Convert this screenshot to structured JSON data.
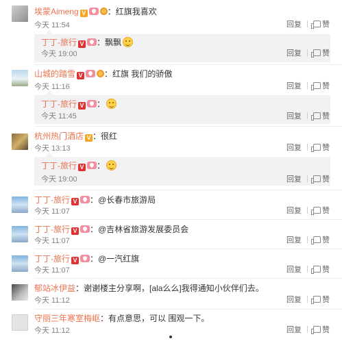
{
  "labels": {
    "reply": "回复",
    "like": "赞"
  },
  "comments": [
    {
      "user": "埃蒙Aimeng",
      "text": "：红旗我喜欢",
      "time": "今天 11:54",
      "reply": {
        "user": "丁丁-旅行",
        "text": "：飘飘",
        "time": "今天 19:00"
      }
    },
    {
      "user": "山城的踏雪",
      "text": "：红旗 我们的骄傲",
      "time": "今天 11:16",
      "reply": {
        "user": "丁丁-旅行",
        "text": "：",
        "time": "今天 11:45"
      }
    },
    {
      "user": "杭州热门酒店",
      "text": "：很红",
      "time": "今天 13:13",
      "reply": {
        "user": "丁丁-旅行",
        "text": "：",
        "time": "今天 19:00"
      }
    },
    {
      "user": "丁丁-旅行",
      "text": "：@长春市旅游局",
      "time": "今天 11:07"
    },
    {
      "user": "丁丁-旅行",
      "text": "：@吉林省旅游发展委员会",
      "time": "今天 11:07"
    },
    {
      "user": "丁丁-旅行",
      "text": "：@一汽红旗",
      "time": "今天 11:07"
    },
    {
      "user": "郁站冰伊益",
      "text": "：谢谢楼主分享啊，[ala么么]我得通知小伙伴们去。",
      "time": "今天 11:12"
    },
    {
      "user": "守丽三年寒室梅岖",
      "text": "：有点意思，可以 围观一下。",
      "time": "今天 11:12"
    }
  ]
}
